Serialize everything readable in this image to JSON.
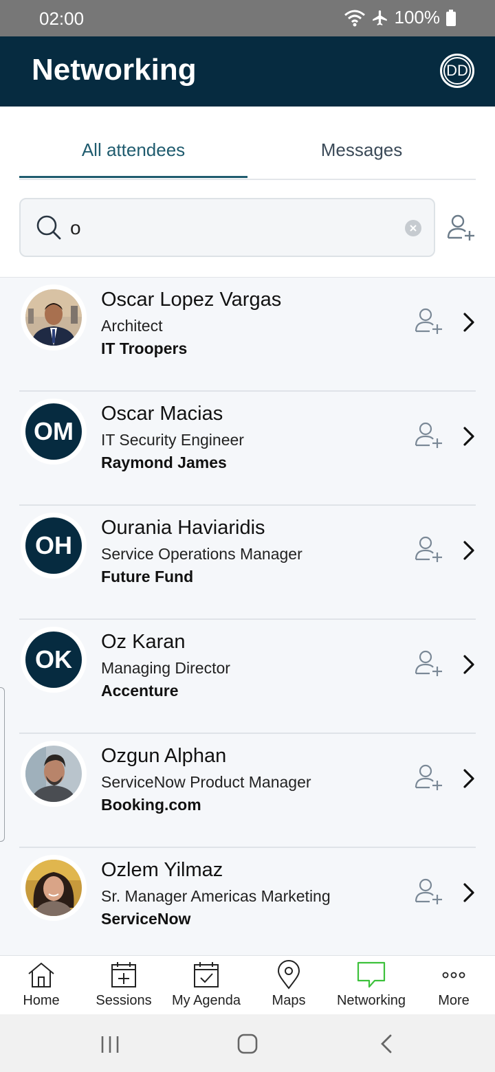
{
  "status_bar": {
    "time": "02:00",
    "battery": "100%"
  },
  "header": {
    "title": "Networking",
    "avatar_initials": "DD"
  },
  "tabs": [
    {
      "label": "All attendees",
      "active": true
    },
    {
      "label": "Messages",
      "active": false
    }
  ],
  "search": {
    "value": "o"
  },
  "attendees": [
    {
      "name": "Oscar Lopez Vargas",
      "title": "Architect",
      "company": "IT Troopers",
      "initials": "",
      "photo": true
    },
    {
      "name": "Oscar Macias",
      "title": "IT Security Engineer",
      "company": "Raymond James",
      "initials": "OM",
      "photo": false
    },
    {
      "name": "Ourania Haviaridis",
      "title": "Service Operations Manager",
      "company": "Future Fund",
      "initials": "OH",
      "photo": false
    },
    {
      "name": "Oz Karan",
      "title": "Managing Director",
      "company": "Accenture",
      "initials": "OK",
      "photo": false
    },
    {
      "name": "Ozgun Alphan",
      "title": "ServiceNow Product Manager",
      "company": "Booking.com",
      "initials": "",
      "photo": true
    },
    {
      "name": "Ozlem Yilmaz",
      "title": "Sr. Manager Americas Marketing",
      "company": "ServiceNow",
      "initials": "",
      "photo": true
    }
  ],
  "bottom_nav": [
    {
      "label": "Home",
      "icon": "home-icon",
      "active": false
    },
    {
      "label": "Sessions",
      "icon": "calendar-plus-icon",
      "active": false
    },
    {
      "label": "My Agenda",
      "icon": "calendar-check-icon",
      "active": false
    },
    {
      "label": "Maps",
      "icon": "map-pin-icon",
      "active": false
    },
    {
      "label": "Networking",
      "icon": "chat-bubble-icon",
      "active": true
    },
    {
      "label": "More",
      "icon": "more-dots-icon",
      "active": false
    }
  ],
  "colors": {
    "header_bg": "#062b40",
    "accent_tab": "#1f5b6e",
    "active_nav": "#3cc13b",
    "avatar_bg": "#062b40"
  }
}
